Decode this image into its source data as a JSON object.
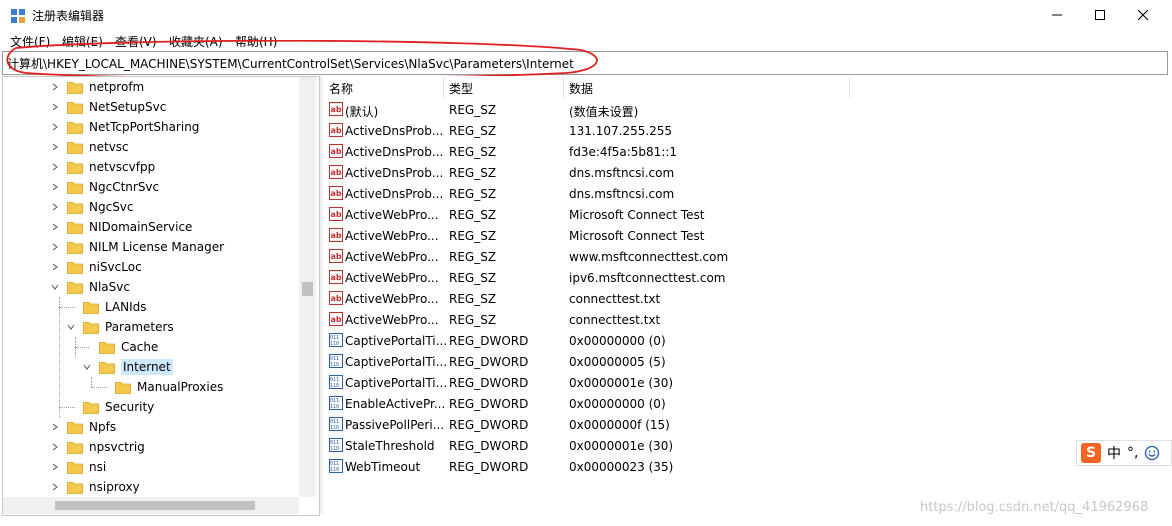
{
  "window": {
    "title": "注册表编辑器"
  },
  "menu": [
    "文件(F)",
    "编辑(E)",
    "查看(V)",
    "收藏夹(A)",
    "帮助(H)"
  ],
  "address": "计算机\\HKEY_LOCAL_MACHINE\\SYSTEM\\CurrentControlSet\\Services\\NlaSvc\\Parameters\\Internet",
  "tree": [
    {
      "label": "netprofm",
      "level": 0,
      "expander": "collapsed"
    },
    {
      "label": "NetSetupSvc",
      "level": 0,
      "expander": "collapsed"
    },
    {
      "label": "NetTcpPortSharing",
      "level": 0,
      "expander": "collapsed"
    },
    {
      "label": "netvsc",
      "level": 0,
      "expander": "collapsed"
    },
    {
      "label": "netvscvfpp",
      "level": 0,
      "expander": "collapsed"
    },
    {
      "label": "NgcCtnrSvc",
      "level": 0,
      "expander": "collapsed"
    },
    {
      "label": "NgcSvc",
      "level": 0,
      "expander": "collapsed"
    },
    {
      "label": "NIDomainService",
      "level": 0,
      "expander": "collapsed"
    },
    {
      "label": "NILM License Manager",
      "level": 0,
      "expander": "collapsed"
    },
    {
      "label": "niSvcLoc",
      "level": 0,
      "expander": "collapsed"
    },
    {
      "label": "NlaSvc",
      "level": 0,
      "expander": "expanded"
    },
    {
      "label": "LANIds",
      "level": 1,
      "expander": "none"
    },
    {
      "label": "Parameters",
      "level": 1,
      "expander": "expanded"
    },
    {
      "label": "Cache",
      "level": 2,
      "expander": "none"
    },
    {
      "label": "Internet",
      "level": 2,
      "expander": "expanded",
      "selected": true
    },
    {
      "label": "ManualProxies",
      "level": 3,
      "expander": "none"
    },
    {
      "label": "Security",
      "level": 1,
      "expander": "none"
    },
    {
      "label": "Npfs",
      "level": 0,
      "expander": "collapsed"
    },
    {
      "label": "npsvctrig",
      "level": 0,
      "expander": "collapsed"
    },
    {
      "label": "nsi",
      "level": 0,
      "expander": "collapsed"
    },
    {
      "label": "nsiproxy",
      "level": 0,
      "expander": "collapsed"
    }
  ],
  "columns": {
    "name": "名称",
    "type": "类型",
    "data": "数据"
  },
  "values": [
    {
      "name": "(默认)",
      "type": "REG_SZ",
      "data": "(数值未设置)",
      "icon": "string-value-icon"
    },
    {
      "name": "ActiveDnsProb...",
      "type": "REG_SZ",
      "data": "131.107.255.255",
      "icon": "string-value-icon"
    },
    {
      "name": "ActiveDnsProb...",
      "type": "REG_SZ",
      "data": "fd3e:4f5a:5b81::1",
      "icon": "string-value-icon"
    },
    {
      "name": "ActiveDnsProb...",
      "type": "REG_SZ",
      "data": "dns.msftncsi.com",
      "icon": "string-value-icon"
    },
    {
      "name": "ActiveDnsProb...",
      "type": "REG_SZ",
      "data": "dns.msftncsi.com",
      "icon": "string-value-icon"
    },
    {
      "name": "ActiveWebPro...",
      "type": "REG_SZ",
      "data": "Microsoft Connect Test",
      "icon": "string-value-icon"
    },
    {
      "name": "ActiveWebPro...",
      "type": "REG_SZ",
      "data": "Microsoft Connect Test",
      "icon": "string-value-icon"
    },
    {
      "name": "ActiveWebPro...",
      "type": "REG_SZ",
      "data": "www.msftconnecttest.com",
      "icon": "string-value-icon"
    },
    {
      "name": "ActiveWebPro...",
      "type": "REG_SZ",
      "data": "ipv6.msftconnecttest.com",
      "icon": "string-value-icon"
    },
    {
      "name": "ActiveWebPro...",
      "type": "REG_SZ",
      "data": "connecttest.txt",
      "icon": "string-value-icon"
    },
    {
      "name": "ActiveWebPro...",
      "type": "REG_SZ",
      "data": "connecttest.txt",
      "icon": "string-value-icon"
    },
    {
      "name": "CaptivePortalTi...",
      "type": "REG_DWORD",
      "data": "0x00000000 (0)",
      "icon": "dword-value-icon"
    },
    {
      "name": "CaptivePortalTi...",
      "type": "REG_DWORD",
      "data": "0x00000005 (5)",
      "icon": "dword-value-icon"
    },
    {
      "name": "CaptivePortalTi...",
      "type": "REG_DWORD",
      "data": "0x0000001e (30)",
      "icon": "dword-value-icon"
    },
    {
      "name": "EnableActivePr...",
      "type": "REG_DWORD",
      "data": "0x00000000 (0)",
      "icon": "dword-value-icon"
    },
    {
      "name": "PassivePollPeri...",
      "type": "REG_DWORD",
      "data": "0x0000000f (15)",
      "icon": "dword-value-icon"
    },
    {
      "name": "StaleThreshold",
      "type": "REG_DWORD",
      "data": "0x0000001e (30)",
      "icon": "dword-value-icon"
    },
    {
      "name": "WebTimeout",
      "type": "REG_DWORD",
      "data": "0x00000023 (35)",
      "icon": "dword-value-icon"
    }
  ],
  "ime": {
    "lang": "中",
    "punct": "°,"
  },
  "watermark": "https://blog.csdn.net/qq_41962968",
  "colors": {
    "selection": "#cce8ff",
    "folder": "#f5c84c",
    "annotation": "#e02020",
    "ime": "#f26522"
  }
}
